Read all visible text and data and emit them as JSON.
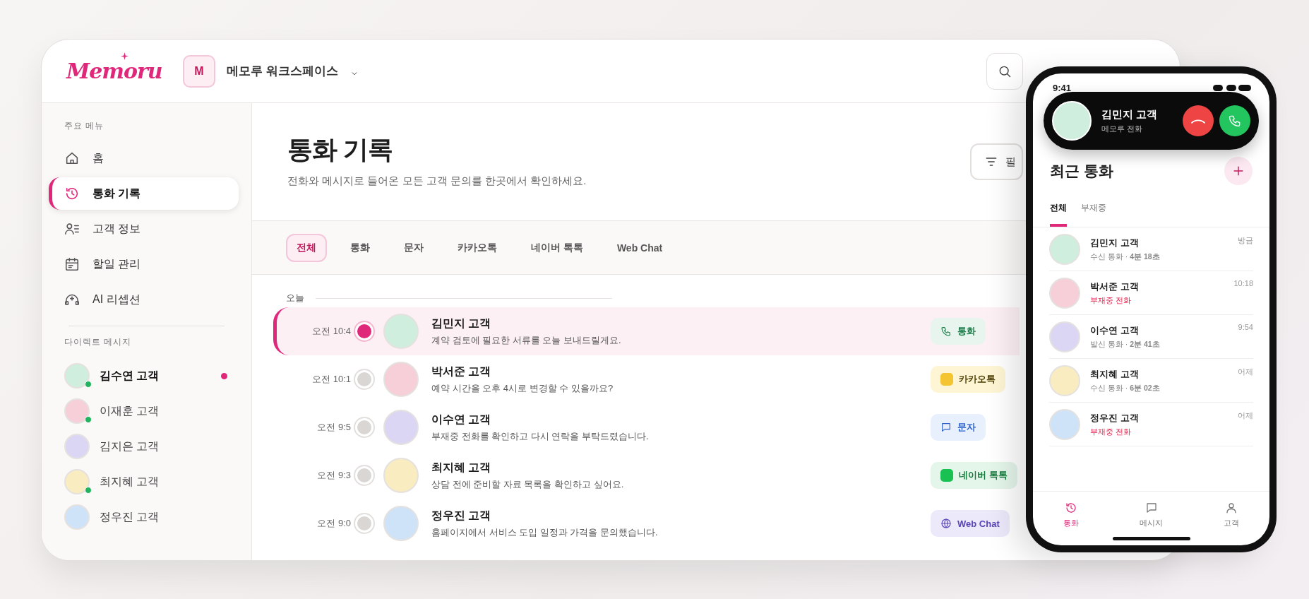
{
  "app": {
    "logo": "Memoru",
    "workspace": {
      "initial": "M",
      "name": "메모루 워크스페이스"
    }
  },
  "sidebar": {
    "menu_heading": "주요 메뉴",
    "items": [
      {
        "label": "홈",
        "kind": "home",
        "selected": false
      },
      {
        "label": "통화 기록",
        "kind": "history",
        "selected": true
      },
      {
        "label": "고객 정보",
        "kind": "contacts",
        "selected": false
      },
      {
        "label": "할일 관리",
        "kind": "calendar",
        "selected": false
      },
      {
        "label": "AI 리셉션",
        "kind": "headset",
        "selected": false
      }
    ],
    "dm_heading": "다이렉트 메시지",
    "dms": [
      {
        "name": "김수연 고객",
        "online": true,
        "unread": true,
        "color": "#cfeedd"
      },
      {
        "name": "이재훈 고객",
        "online": true,
        "unread": false,
        "color": "#f6cfd8"
      },
      {
        "name": "김지은 고객",
        "online": false,
        "unread": false,
        "color": "#dcd6f5"
      },
      {
        "name": "최지혜 고객",
        "online": true,
        "unread": false,
        "color": "#f8ecc0"
      },
      {
        "name": "정우진 고객",
        "online": false,
        "unread": false,
        "color": "#cfe3f8"
      }
    ]
  },
  "page": {
    "title": "통화 기록",
    "subtitle": "전화와 메시지로 들어온 모든 고객 문의를 한곳에서 확인하세요.",
    "filter_button": "필"
  },
  "tabs": [
    {
      "label": "전체",
      "selected": true
    },
    {
      "label": "통화",
      "selected": false
    },
    {
      "label": "문자",
      "selected": false
    },
    {
      "label": "카카오톡",
      "selected": false
    },
    {
      "label": "네이버 톡톡",
      "selected": false
    },
    {
      "label": "Web Chat",
      "selected": false
    }
  ],
  "timeline": {
    "group": "오늘",
    "rows": [
      {
        "time": "오전 10:4",
        "name": "김민지 고객",
        "message": "계약 검토에 필요한 서류를 오늘 보내드릴게요.",
        "selected": true,
        "color": "#cfeedd",
        "channel": {
          "kind": "call",
          "label": "통화"
        }
      },
      {
        "time": "오전 10:1",
        "name": "박서준 고객",
        "message": "예약 시간을 오후 4시로 변경할 수 있을까요?",
        "selected": false,
        "color": "#f6cfd8",
        "channel": {
          "kind": "kakao",
          "label": "카카오톡"
        }
      },
      {
        "time": "오전 9:5",
        "name": "이수연 고객",
        "message": "부재중 전화를 확인하고 다시 연락을 부탁드렸습니다.",
        "selected": false,
        "color": "#dcd6f5",
        "channel": {
          "kind": "sms",
          "label": "문자"
        }
      },
      {
        "time": "오전 9:3",
        "name": "최지혜 고객",
        "message": "상담 전에 준비할 자료 목록을 확인하고 싶어요.",
        "selected": false,
        "color": "#f8ecc0",
        "channel": {
          "kind": "naver",
          "label": "네이버 톡톡"
        }
      },
      {
        "time": "오전 9:0",
        "name": "정우진 고객",
        "message": "홈페이지에서 서비스 도입 일정과 가격을 문의했습니다.",
        "selected": false,
        "color": "#cfe3f8",
        "channel": {
          "kind": "web",
          "label": "Web Chat"
        }
      }
    ]
  },
  "phone": {
    "clock": "9:41",
    "incoming": {
      "name": "김민지 고객",
      "subtitle": "메모루 전화",
      "color": "#cfeedd"
    },
    "title": "최근 통화",
    "tabs": [
      {
        "label": "전체",
        "selected": true
      },
      {
        "label": "부재중",
        "selected": false
      }
    ],
    "calls": [
      {
        "name": "김민지 고객",
        "detail": "수신 통화 · **4분 18초**",
        "time": "방금",
        "missed": false,
        "color": "#cfeedd"
      },
      {
        "name": "박서준 고객",
        "detail": "부재중 전화",
        "time": "10:18",
        "missed": true,
        "color": "#f6cfd8"
      },
      {
        "name": "이수연 고객",
        "detail": "발신 통화 · **2분 41초**",
        "time": "9:54",
        "missed": false,
        "color": "#dcd6f5"
      },
      {
        "name": "최지혜 고객",
        "detail": "수신 통화 · **6분 02초**",
        "time": "어제",
        "missed": false,
        "color": "#f8ecc0"
      },
      {
        "name": "정우진 고객",
        "detail": "부재중 전화",
        "time": "어제",
        "missed": true,
        "color": "#cfe3f8"
      }
    ],
    "nav": [
      {
        "label": "통화",
        "kind": "history",
        "selected": true
      },
      {
        "label": "메시지",
        "kind": "chat",
        "selected": false
      },
      {
        "label": "고객",
        "kind": "person",
        "selected": false
      }
    ]
  }
}
